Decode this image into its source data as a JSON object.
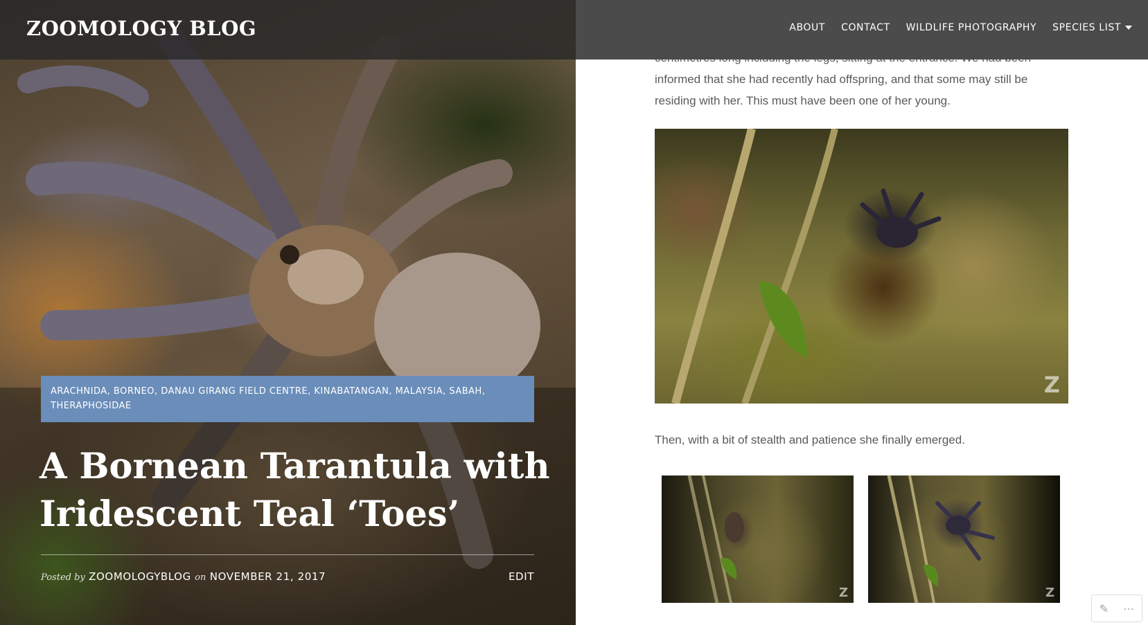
{
  "site": {
    "title": "ZOOMOLOGY BLOG"
  },
  "nav": {
    "items": [
      "ABOUT",
      "CONTACT",
      "WILDLIFE PHOTOGRAPHY",
      "SPECIES LIST"
    ]
  },
  "post": {
    "categories": "ARACHNIDA, BORNEO, DANAU GIRANG FIELD CENTRE, KINABATANGAN, MALAYSIA, SABAH, THERAPHOSIDAE",
    "title": "A Bornean Tarantula with Iridescent Teal ‘Toes’",
    "posted_by_label": "Posted by",
    "author": "ZOOMOLOGYBLOG",
    "on_label": "on",
    "date": "NOVEMBER 21, 2017",
    "edit_label": "EDIT"
  },
  "content": {
    "para1": "One night, we returned to the tree and saw a small tarantula, maybe five centimetres long including the legs, sitting at the entrance. We had been informed that she had recently had offspring, and that some may still be residing with her. This must have been one of her young.",
    "para2": "Then, with a bit of stealth and patience she finally emerged.",
    "watermark": "Z"
  },
  "admin": {
    "edit_icon": "✎",
    "more_icon": "⋯"
  },
  "colors": {
    "category_bg": "#6a8dba",
    "header_bg": "#4b4b4b",
    "body_text": "#5a5a5a"
  }
}
